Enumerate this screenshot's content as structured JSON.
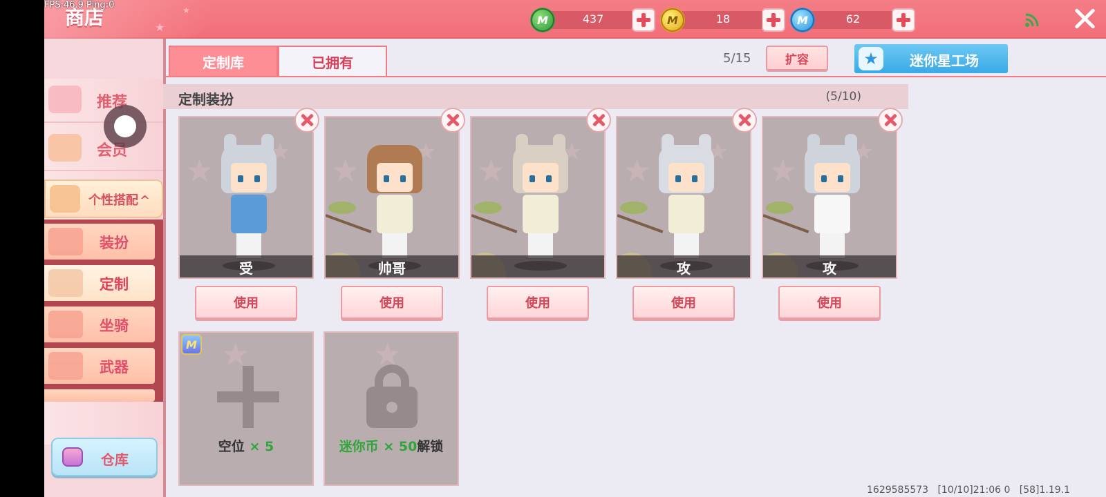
{
  "debug": {
    "fps_text": "FPS:46.9  Ping:0"
  },
  "header": {
    "title": "商店",
    "currencies": [
      {
        "name": "green-gem",
        "value": "437",
        "color": "#3aa34a"
      },
      {
        "name": "gold-coin",
        "value": "18",
        "color": "#e0a91a"
      },
      {
        "name": "mini-coin",
        "value": "62",
        "color": "#2d94e0"
      }
    ]
  },
  "sidebar": {
    "items": [
      {
        "label": "推荐",
        "icon": "thumbs-up-icon"
      },
      {
        "label": "会员",
        "icon": "vip-card-icon"
      }
    ],
    "group": {
      "label": "个性搭配",
      "expanded": true,
      "arrow": "^"
    },
    "subitems": [
      {
        "label": "装扮",
        "icon": "shirt-icon",
        "active": false
      },
      {
        "label": "定制",
        "icon": "brush-icon",
        "active": true
      },
      {
        "label": "坐骑",
        "icon": "saddle-icon",
        "active": false
      },
      {
        "label": "武器",
        "icon": "gun-icon",
        "active": false
      }
    ],
    "warehouse_label": "仓库"
  },
  "tabs": [
    {
      "label": "定制库",
      "active": true
    },
    {
      "label": "已拥有",
      "active": false
    }
  ],
  "toolbar": {
    "capacity": "5/15",
    "expand_label": "扩容",
    "workshop_label": "迷你星工场"
  },
  "section": {
    "title": "定制装扮",
    "count": "(5/10)"
  },
  "outfits": [
    {
      "name": "受",
      "use_label": "使用",
      "hair": "#cfd3dc",
      "body": "#5b9bd8",
      "has_ears": true
    },
    {
      "name": "帅哥",
      "use_label": "使用",
      "hair": "#b07a52",
      "body": "#f2edd6",
      "has_ears": false
    },
    {
      "name": "",
      "use_label": "使用",
      "hair": "#d9cfc3",
      "body": "#f2edd6",
      "has_ears": true
    },
    {
      "name": "攻",
      "use_label": "使用",
      "hair": "#d9dce3",
      "body": "#f2edd6",
      "has_ears": true
    },
    {
      "name": "攻",
      "use_label": "使用",
      "hair": "#cfd3dc",
      "body": "#f7f7f7",
      "has_ears": true
    }
  ],
  "slots": {
    "empty": {
      "label": "空位",
      "count": "× 5"
    },
    "locked": {
      "currency": "迷你币",
      "amount": "× 50",
      "action": "解锁"
    }
  },
  "footer": {
    "id": "1629585573",
    "time": "[10/10]21:06 0",
    "version": "[58]1.19.1"
  }
}
